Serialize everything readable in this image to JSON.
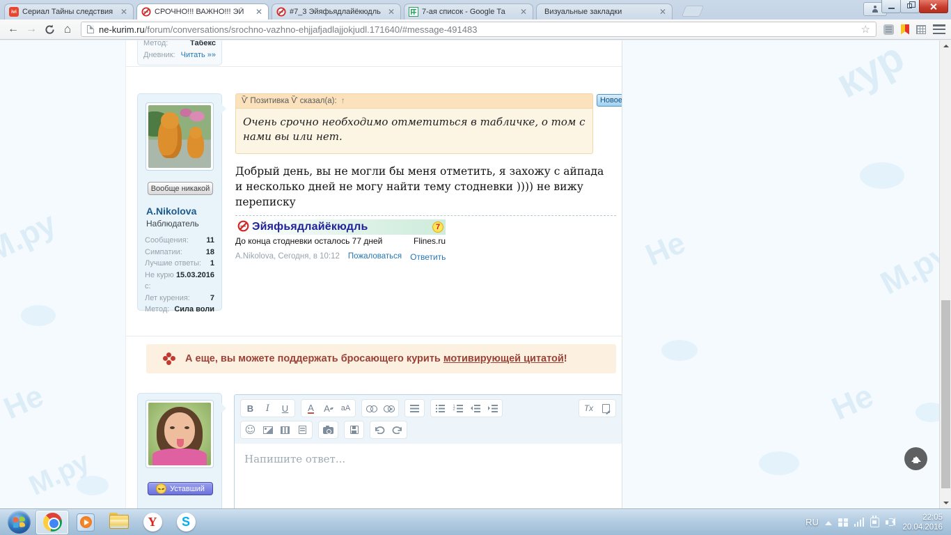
{
  "browser": {
    "tabs": [
      {
        "title": "Сериал Тайны следствия"
      },
      {
        "title": "СРОЧНО!!! ВАЖНО!!! ЭЙ"
      },
      {
        "title": "#7_3 Эйяфьядлайёкюдль"
      },
      {
        "title": "7-ая список - Google Та"
      },
      {
        "title": "Визуальные закладки"
      }
    ],
    "url_host": "ne-kurim.ru",
    "url_path": "/forum/conversations/srochno-vazhno-ehjjafjadlajjokjudl.171640/#message-491483"
  },
  "prev_post": {
    "rows": [
      {
        "label": "Метод:",
        "value": "Табекс"
      },
      {
        "label": "Дневник:",
        "value": "Читать »»"
      }
    ]
  },
  "post": {
    "quote_header": "Ѷ Позитивка Ѷ сказал(а):",
    "quote_arrow": "↑",
    "quote_text": "Очень срочно необходимо отметиться в табличке, о том с нами вы или нет.",
    "new_badge": "Новое",
    "body": "Добрый день, вы не могли бы меня отметить, я захожу с айпада и несколько дней не могу найти тему стодневки )))) не вижу переписку",
    "author": "A.Nikolova",
    "role": "Наблюдатель",
    "mood": "Вообще никакой",
    "stats": [
      {
        "label": "Сообщения:",
        "value": "11"
      },
      {
        "label": "Симпатии:",
        "value": "18"
      },
      {
        "label": "Лучшие ответы:",
        "value": "1"
      },
      {
        "label": "Не курю с:",
        "value": "15.03.2016"
      },
      {
        "label": "Лет курения:",
        "value": "7"
      },
      {
        "label": "Метод:",
        "value": "Сила воли"
      }
    ],
    "signature": {
      "title": "Эйяфьядлайёкюдль",
      "badge": "7",
      "subtitle": "До конца стодневки осталось 77 дней",
      "brand": "Flines.ru"
    },
    "meta": "A.Nikolova, Сегодня, в 10:12",
    "report_link": "Пожаловаться",
    "reply_link": "Ответить"
  },
  "promo": {
    "text_before": "А еще, вы можете поддержать бросающего курить ",
    "link": "мотивирующей цитатой",
    "text_after": "!"
  },
  "reply": {
    "mood": "Уставший",
    "placeholder": "Напишите ответ..."
  },
  "editor": {
    "bold": "B",
    "italic": "I",
    "underline": "U",
    "text_color": "A",
    "font_size": "A",
    "font_family": "aA",
    "remove_format": "Tx",
    "smiley": "☺"
  },
  "taskbar": {
    "lang": "RU",
    "time": "22:05",
    "date": "20.04.2016"
  },
  "watermark": {
    "f0": "кур",
    "f1": "М.ру",
    "f2": "Не",
    "f3": "Не",
    "f4": "М.ру",
    "f5": "Не",
    "f6": "М.ру"
  }
}
